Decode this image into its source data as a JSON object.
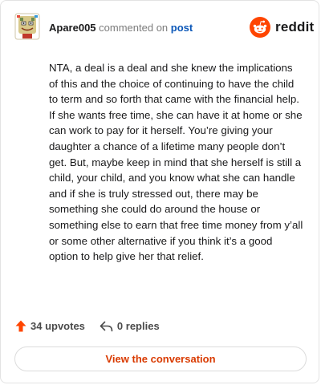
{
  "comment": {
    "username": "Apare005",
    "action_text": "commented on",
    "post_link": "post",
    "body": "NTA, a deal is a deal and she knew the implications of this and the choice of continuing to have the child to term and so forth that came with the financial help. If she wants free time, she can have it at home or she can work to pay for it herself. You’re giving your daughter a chance of a lifetime many people don’t get. But, maybe keep in mind that she herself is still a child, your child, and you know what she can handle and if she is truly stressed out, there may be something she could do around the house or something else to earn that free time money from y’all or some other alternative if you think it’s a good option to help give her that relief."
  },
  "brand": {
    "name": "reddit",
    "icon": "reddit-snoo-icon",
    "color": "#ff4500"
  },
  "actions": {
    "upvotes_label": "34 upvotes",
    "upvote_icon": "upvote-arrow-icon",
    "upvote_color": "#ff4500",
    "replies_label": "0 replies",
    "reply_icon": "reply-arrow-icon"
  },
  "view_button_label": "View the conversation",
  "colors": {
    "link_blue": "#0b57b8",
    "accent_orange": "#d93a00"
  }
}
